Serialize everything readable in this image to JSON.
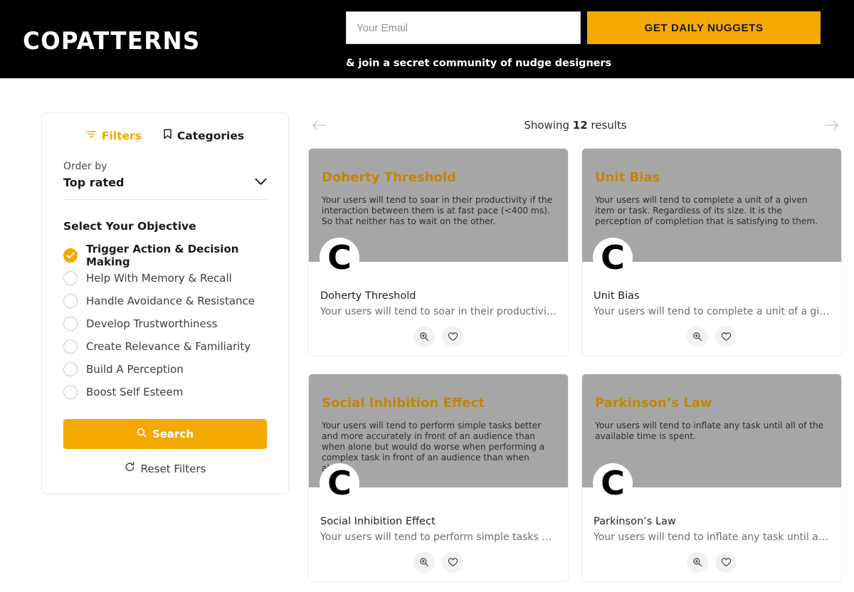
{
  "header": {
    "logo": "COPATTERNS",
    "email_placeholder": "Your Email",
    "email_value": "",
    "cta_label": "GET DAILY NUGGETS",
    "tagline": "& join a secret community of nudge designers",
    "accent_color": "#F5A800",
    "background_color": "#000000"
  },
  "sidebar": {
    "tabs": [
      {
        "label": "Filters",
        "icon": "filter-icon",
        "active": true
      },
      {
        "label": "Categories",
        "icon": "bookmark-icon",
        "active": false
      }
    ],
    "order_by": {
      "label": "Order by",
      "value": "Top rated",
      "options": [
        "Top rated"
      ]
    },
    "objective": {
      "title": "Select Your Objective",
      "options": [
        {
          "label": "Trigger Action & Decision Making",
          "selected": true
        },
        {
          "label": "Help With Memory & Recall",
          "selected": false
        },
        {
          "label": "Handle Avoidance & Resistance",
          "selected": false
        },
        {
          "label": "Develop Trustworthiness",
          "selected": false
        },
        {
          "label": "Create Relevance & Familiarity",
          "selected": false
        },
        {
          "label": "Build A Perception",
          "selected": false
        },
        {
          "label": "Boost Self Esteem",
          "selected": false
        }
      ]
    },
    "search_label": "Search",
    "reset_label": "Reset Filters"
  },
  "results": {
    "showing_prefix": "Showing ",
    "count": "12",
    "showing_suffix": " results",
    "prev_icon": "arrow-left-icon",
    "next_icon": "arrow-right-icon",
    "card_title_color": "#C0860B",
    "card_cover_color": "#A6A6A6",
    "avatar_letter": "C",
    "action_icons": [
      "zoom-in-icon",
      "heart-icon"
    ],
    "cards": [
      {
        "title": "Doherty Threshold",
        "description": "Your users will tend to soar in their productivity if the interaction between them is at fast pace (<400 ms). So that neither has to wait on the other.",
        "name": "Doherty Threshold",
        "snippet": "Your users will tend to soar in their productivity …"
      },
      {
        "title": "Unit Bias",
        "description": "Your users will tend to complete a unit of a given item or task. Regardless of its size. It is the perception of completion that is satisfying to them.",
        "name": "Unit Bias",
        "snippet": "Your users will tend to complete a unit of a give…"
      },
      {
        "title": "Social Inhibition Effect",
        "description": "Your users will tend to perform simple tasks better and more accurately in front of an audience than when alone but would do worse when performing a complex task in front of an audience than when alone.",
        "name": "Social Inhibition Effect",
        "snippet": "Your users will tend to perform simple tasks bet…"
      },
      {
        "title": "Parkinson’s Law",
        "description": "Your users will tend to inflate any task until all of the available time is spent.",
        "name": "Parkinson’s Law",
        "snippet": "Your users will tend to inflate any task until all o…"
      }
    ]
  }
}
